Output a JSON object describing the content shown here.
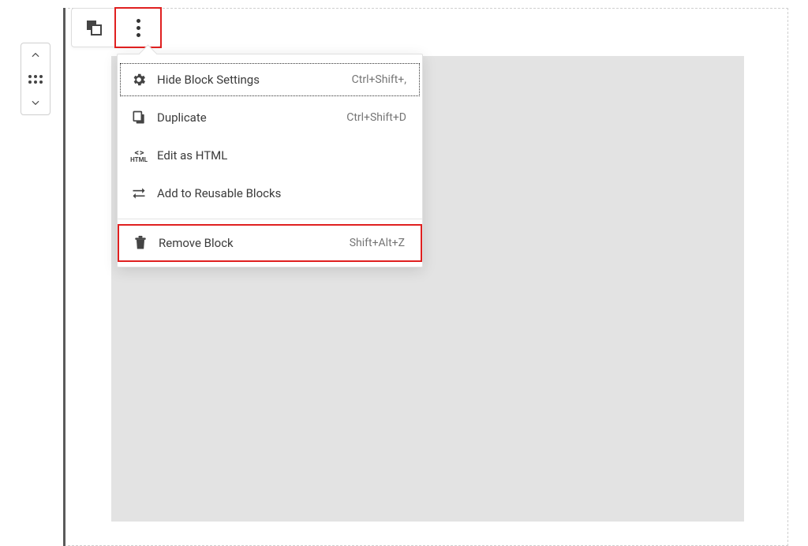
{
  "menu": {
    "items": [
      {
        "label": "Hide Block Settings",
        "shortcut": "Ctrl+Shift+,"
      },
      {
        "label": "Duplicate",
        "shortcut": "Ctrl+Shift+D"
      },
      {
        "label": "Edit as HTML",
        "shortcut": ""
      },
      {
        "label": "Add to Reusable Blocks",
        "shortcut": ""
      },
      {
        "label": "Remove Block",
        "shortcut": "Shift+Alt+Z"
      }
    ]
  }
}
